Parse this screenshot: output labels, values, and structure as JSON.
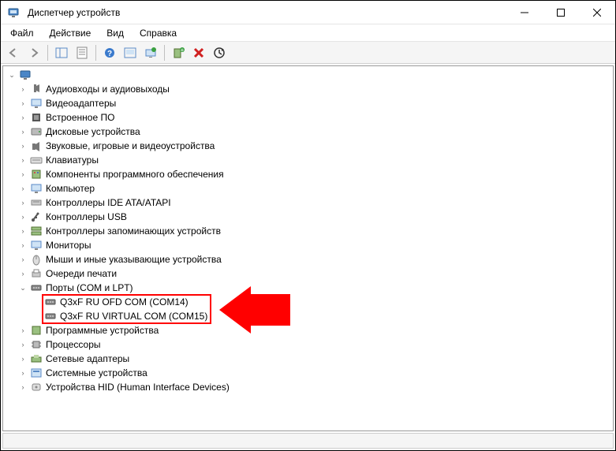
{
  "window": {
    "title": "Диспетчер устройств"
  },
  "menu": {
    "items": [
      "Файл",
      "Действие",
      "Вид",
      "Справка"
    ]
  },
  "toolbar": {
    "buttons": [
      "back",
      "forward",
      "sep",
      "show-hide",
      "properties",
      "sep",
      "help",
      "update",
      "uninstall",
      "scan",
      "sep",
      "add-legacy",
      "remove",
      "refresh-circle"
    ]
  },
  "tree": {
    "root": {
      "expanded": true,
      "icon": "computer",
      "children": [
        {
          "icon": "audio",
          "label": "Аудиовходы и аудиовыходы",
          "expandable": true
        },
        {
          "icon": "display",
          "label": "Видеоадаптеры",
          "expandable": true
        },
        {
          "icon": "firmware",
          "label": "Встроенное ПО",
          "expandable": true
        },
        {
          "icon": "disk",
          "label": "Дисковые устройства",
          "expandable": true
        },
        {
          "icon": "media",
          "label": "Звуковые, игровые и видеоустройства",
          "expandable": true
        },
        {
          "icon": "keyboard",
          "label": "Клавиатуры",
          "expandable": true
        },
        {
          "icon": "software",
          "label": "Компоненты программного обеспечения",
          "expandable": true
        },
        {
          "icon": "monitor",
          "label": "Компьютер",
          "expandable": true
        },
        {
          "icon": "ide",
          "label": "Контроллеры IDE ATA/ATAPI",
          "expandable": true
        },
        {
          "icon": "usb",
          "label": "Контроллеры USB",
          "expandable": true
        },
        {
          "icon": "storage",
          "label": "Контроллеры запоминающих устройств",
          "expandable": true
        },
        {
          "icon": "monitor2",
          "label": "Мониторы",
          "expandable": true
        },
        {
          "icon": "mouse",
          "label": "Мыши и иные указывающие устройства",
          "expandable": true
        },
        {
          "icon": "printq",
          "label": "Очереди печати",
          "expandable": true
        },
        {
          "icon": "ports",
          "label": "Порты (COM и LPT)",
          "expandable": true,
          "expanded": true,
          "children": [
            {
              "icon": "port",
              "label": "Q3xF RU OFD COM (COM14)",
              "expandable": false,
              "highlighted": true
            },
            {
              "icon": "port",
              "label": "Q3xF RU VIRTUAL COM (COM15)",
              "expandable": false,
              "highlighted": true
            }
          ]
        },
        {
          "icon": "softdev",
          "label": "Программные устройства",
          "expandable": true
        },
        {
          "icon": "cpu",
          "label": "Процессоры",
          "expandable": true
        },
        {
          "icon": "network",
          "label": "Сетевые адаптеры",
          "expandable": true
        },
        {
          "icon": "system",
          "label": "Системные устройства",
          "expandable": true
        },
        {
          "icon": "hid",
          "label": "Устройства HID (Human Interface Devices)",
          "expandable": true
        }
      ]
    }
  },
  "annotation": {
    "arrow_color": "#ff0000"
  }
}
